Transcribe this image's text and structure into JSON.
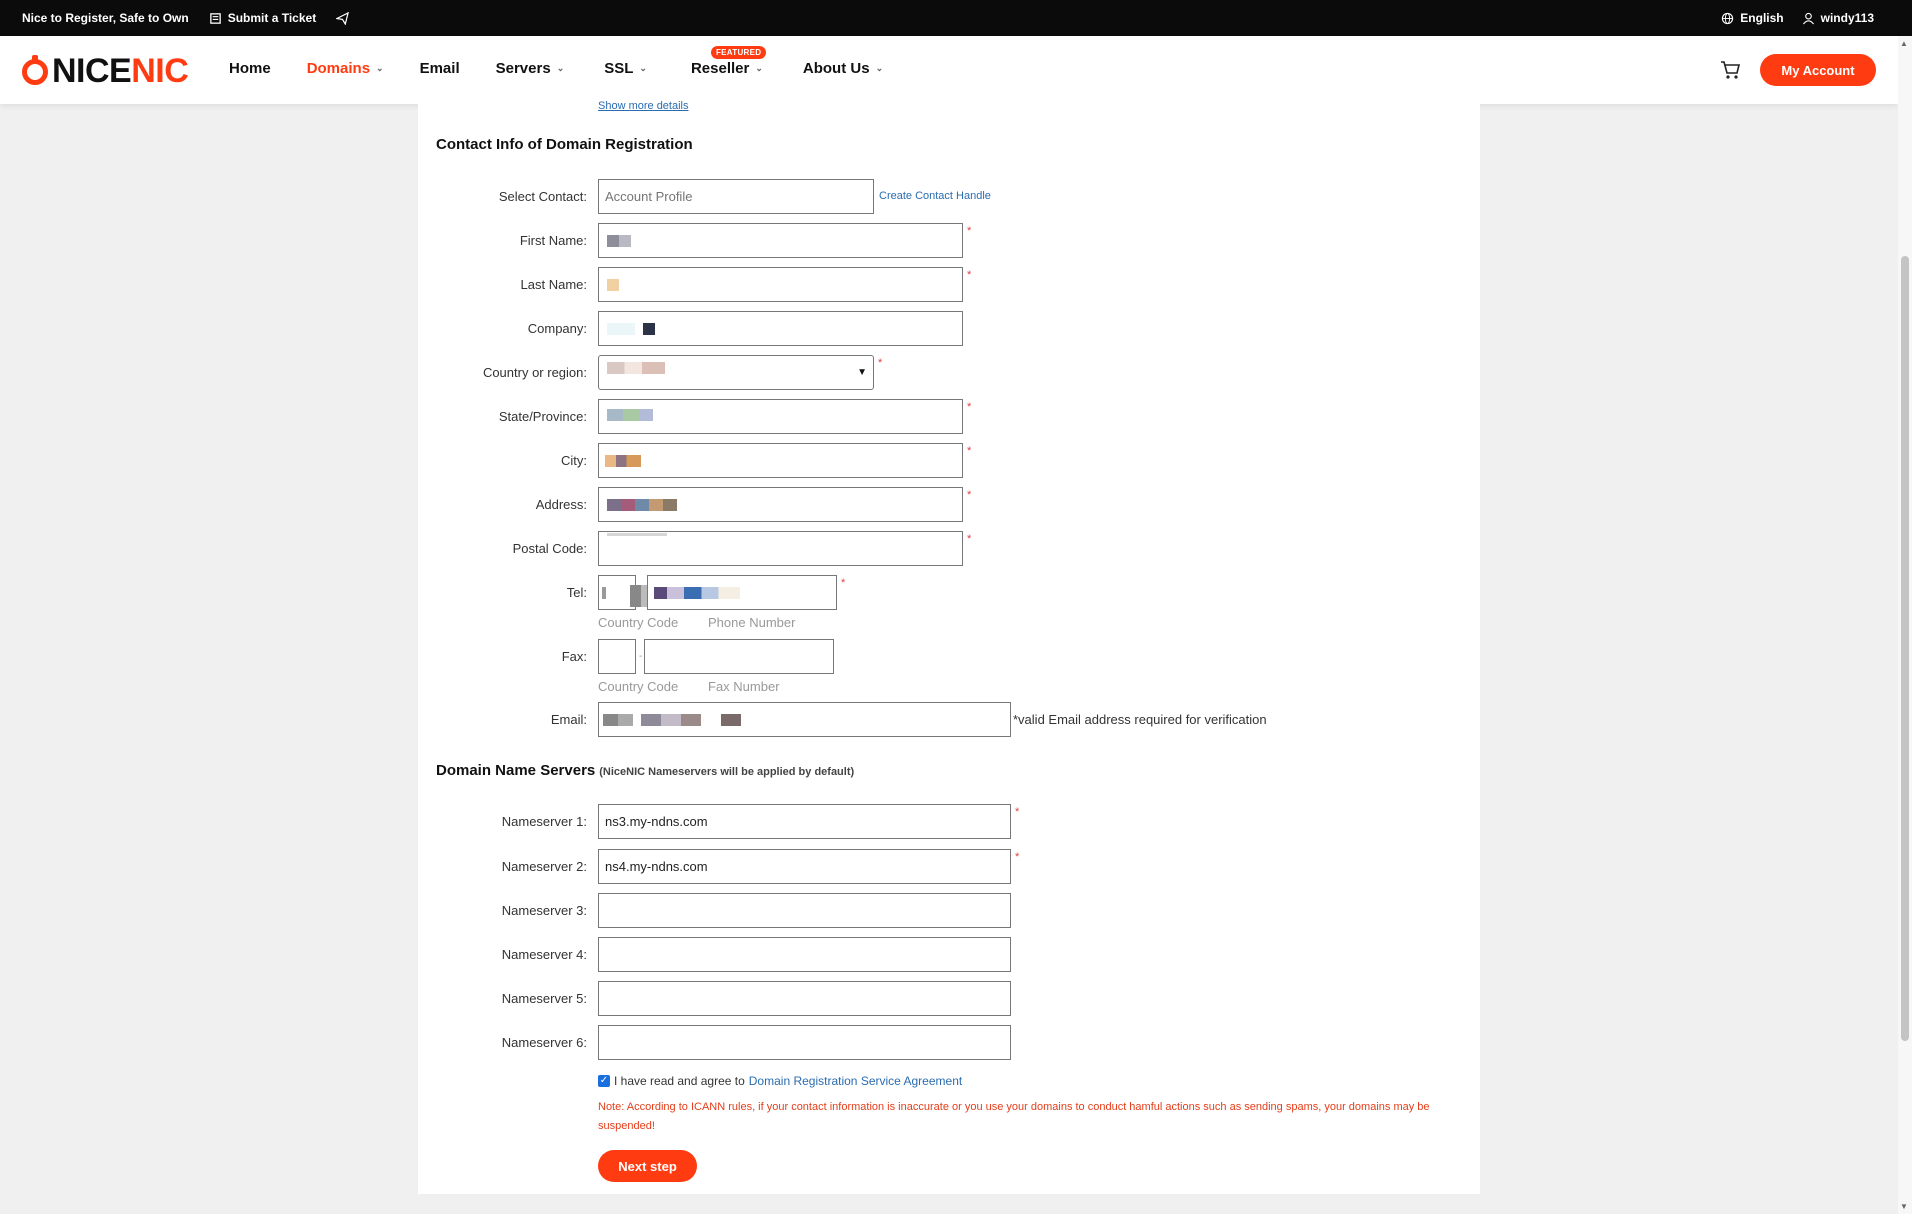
{
  "topbar": {
    "tagline": "Nice to Register, Safe to Own",
    "ticket": "Submit a Ticket",
    "language": "English",
    "username": "windy113"
  },
  "nav": {
    "brand_a": "NICE",
    "brand_b": "NIC",
    "items": [
      {
        "label": "Home"
      },
      {
        "label": "Domains"
      },
      {
        "label": "Email"
      },
      {
        "label": "Servers"
      },
      {
        "label": "SSL"
      },
      {
        "label": "Reseller",
        "badge": "FEATURED"
      },
      {
        "label": "About Us"
      }
    ],
    "account": "My Account"
  },
  "contact": {
    "show_more": "Show more details",
    "title": "Contact Info of Domain Registration",
    "select_contact": {
      "label": "Select Contact:",
      "placeholder": "Account Profile",
      "link": "Create Contact Handle"
    },
    "first_name": "First Name:",
    "last_name": "Last Name:",
    "company": "Company:",
    "country": "Country or region:",
    "state": "State/Province:",
    "city": "City:",
    "address": "Address:",
    "postal": "Postal Code:",
    "tel": {
      "label": "Tel:",
      "country_code": "Country Code",
      "phone": "Phone Number"
    },
    "fax": {
      "label": "Fax:",
      "country_code": "Country Code",
      "number": "Fax Number"
    },
    "email": {
      "label": "Email:",
      "hint": "*valid Email address required for verification"
    }
  },
  "dns": {
    "title": "Domain Name Servers",
    "subtitle": "(NiceNIC Nameservers will be applied by default)",
    "ns": [
      {
        "label": "Nameserver 1:",
        "value": "ns3.my-ndns.com"
      },
      {
        "label": "Nameserver 2:",
        "value": "ns4.my-ndns.com"
      },
      {
        "label": "Nameserver 3:",
        "value": ""
      },
      {
        "label": "Nameserver 4:",
        "value": ""
      },
      {
        "label": "Nameserver 5:",
        "value": ""
      },
      {
        "label": "Nameserver 6:",
        "value": ""
      }
    ]
  },
  "agreement": {
    "text": "I have read and agree to",
    "link": "Domain Registration Service Agreement"
  },
  "note": "Note: According to ICANN rules, if your contact information is inaccurate or you use your domains to conduct hamful actions such as sending spams, your domains may be suspended!",
  "next_button": "Next step",
  "colors": {
    "brand": "#ff3c11",
    "link": "#2b6cb0",
    "required": "#e53e3e"
  }
}
